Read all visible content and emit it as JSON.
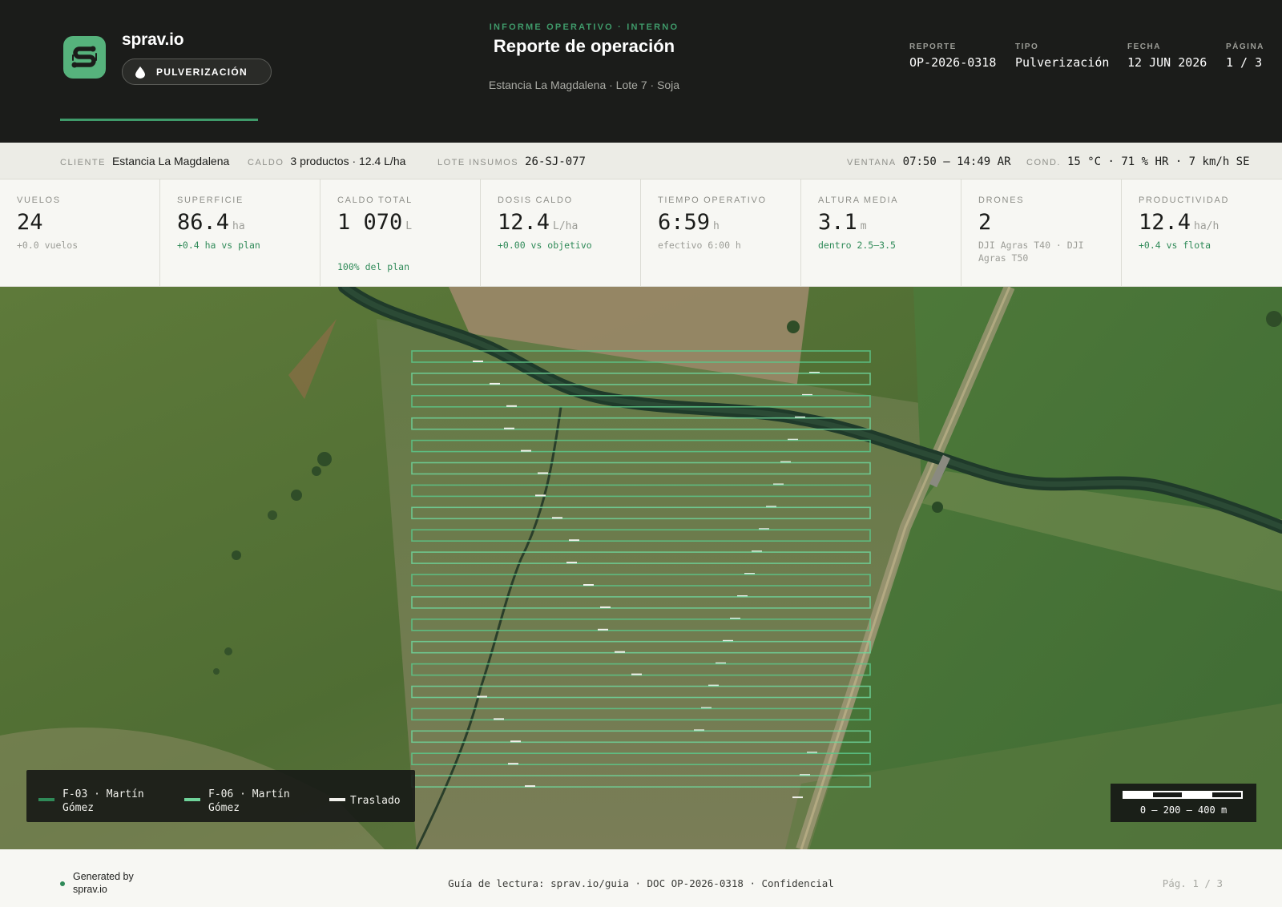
{
  "header": {
    "brand": "sprav.io",
    "badge": "PULVERIZACIÓN",
    "kicker": "INFORME OPERATIVO · INTERNO",
    "title": "Reporte de operación",
    "subtitle": "Estancia La Magdalena · Lote 7 · Soja",
    "meta": [
      {
        "label": "REPORTE",
        "value": "OP-2026-0318"
      },
      {
        "label": "TIPO",
        "value": "Pulverización"
      },
      {
        "label": "FECHA",
        "value": "12 JUN 2026"
      },
      {
        "label": "PÁGINA",
        "value": "1 / 3"
      }
    ]
  },
  "strip": {
    "cliente": {
      "label": "CLIENTE",
      "value": "Estancia La Magdalena"
    },
    "caldo": {
      "label": "CALDO",
      "value": "3 productos · 12.4 L/ha"
    },
    "lote": {
      "label": "LOTE INSUMOS",
      "value": "26-SJ-077"
    },
    "ventana": {
      "label": "VENTANA",
      "value": "07:50 — 14:49 AR"
    },
    "cond": {
      "label": "COND.",
      "value": "15 °C · 71 % HR · 7 km/h SE"
    }
  },
  "kpis": [
    {
      "label": "VUELOS",
      "value": "24",
      "unit": "",
      "sub": "+0.0 vuelos",
      "tone": "muted"
    },
    {
      "label": "SUPERFICIE",
      "value": "86.4",
      "unit": "ha",
      "sub": "+0.4 ha vs plan",
      "tone": "green"
    },
    {
      "label": "CALDO TOTAL",
      "value": "1 070",
      "unit": "L",
      "sub": "100% del plan",
      "tone": "green-low"
    },
    {
      "label": "DOSIS CALDO",
      "value": "12.4",
      "unit": "L/ha",
      "sub": "+0.00 vs objetivo",
      "tone": "green"
    },
    {
      "label": "TIEMPO OPERATIVO",
      "value": "6:59",
      "unit": "h",
      "sub": "efectivo 6:00 h",
      "tone": "muted"
    },
    {
      "label": "ALTURA MEDIA",
      "value": "3.1",
      "unit": "m",
      "sub": "dentro 2.5–3.5",
      "tone": "green"
    },
    {
      "label": "DRONES",
      "value": "2",
      "unit": "",
      "sub": "DJI Agras T40 · DJI Agras T50",
      "tone": "muted"
    },
    {
      "label": "PRODUCTIVIDAD",
      "value": "12.4",
      "unit": "ha/h",
      "sub": "+0.4 vs flota",
      "tone": "green"
    }
  ],
  "map": {
    "legend": [
      {
        "label": "F-03 · Martín Gómez",
        "color": "#2f8a58"
      },
      {
        "label": "F-06 · Martín Gómez",
        "color": "#6fd39a"
      },
      {
        "label": "Traslado",
        "color": "#f1f1ec"
      }
    ],
    "scale": "0 — 200 — 400 m",
    "pass_count": 20
  },
  "footer": {
    "generated": "Generated by sprav.io",
    "guide": "Guía de lectura: sprav.io/guia · DOC OP-2026-0318 · Confidencial",
    "page": "Pág. 1 / 3"
  },
  "colors": {
    "accent": "#3f9a6a",
    "dark": "#1b1c1a",
    "positive": "#2f8a58"
  }
}
